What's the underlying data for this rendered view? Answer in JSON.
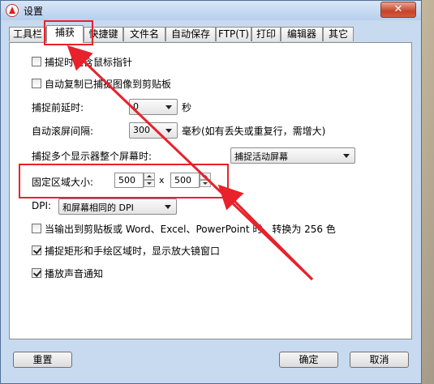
{
  "window": {
    "title": "设置",
    "close_glyph": "✕"
  },
  "tabs": [
    {
      "label": "工具栏"
    },
    {
      "label": "捕获"
    },
    {
      "label": "快捷键"
    },
    {
      "label": "文件名"
    },
    {
      "label": "自动保存"
    },
    {
      "label": "FTP(T)"
    },
    {
      "label": "打印"
    },
    {
      "label": "编辑器"
    },
    {
      "label": "其它"
    }
  ],
  "active_tab": "捕获",
  "capture": {
    "include_cursor": {
      "label": "捕捉时包含鼠标指针",
      "checked": false
    },
    "auto_copy": {
      "label": "自动复制已捕捉图像到剪贴板",
      "checked": false
    },
    "delay": {
      "label": "捕捉前延时:",
      "value": "0",
      "unit": "秒"
    },
    "scroll_interval": {
      "label": "自动滚屏间隔:",
      "value": "300",
      "unit": "毫秒(如有丢失或重复行，需增大)"
    },
    "multi_monitor": {
      "label": "捕捉多个显示器整个屏幕时:",
      "value": "捕捉活动屏幕"
    },
    "fixed_region": {
      "label": "固定区域大小:",
      "width": "500",
      "x_sep": "x",
      "height": "500"
    },
    "dpi": {
      "label": "DPI:",
      "value": "和屏幕相同的 DPI"
    },
    "to_256": {
      "label": "当输出到剪贴板或 Word、Excel、PowerPoint 时，转换为 256 色",
      "checked": false
    },
    "magnifier": {
      "label": "捕捉矩形和手绘区域时，显示放大镜窗口",
      "checked": true
    },
    "sound": {
      "label": "播放声音通知",
      "checked": true
    }
  },
  "buttons": {
    "reset": "重置",
    "ok": "确定",
    "cancel": "取消"
  },
  "colors": {
    "highlight": "#e8212b",
    "titlebar": "#c8daf0"
  }
}
